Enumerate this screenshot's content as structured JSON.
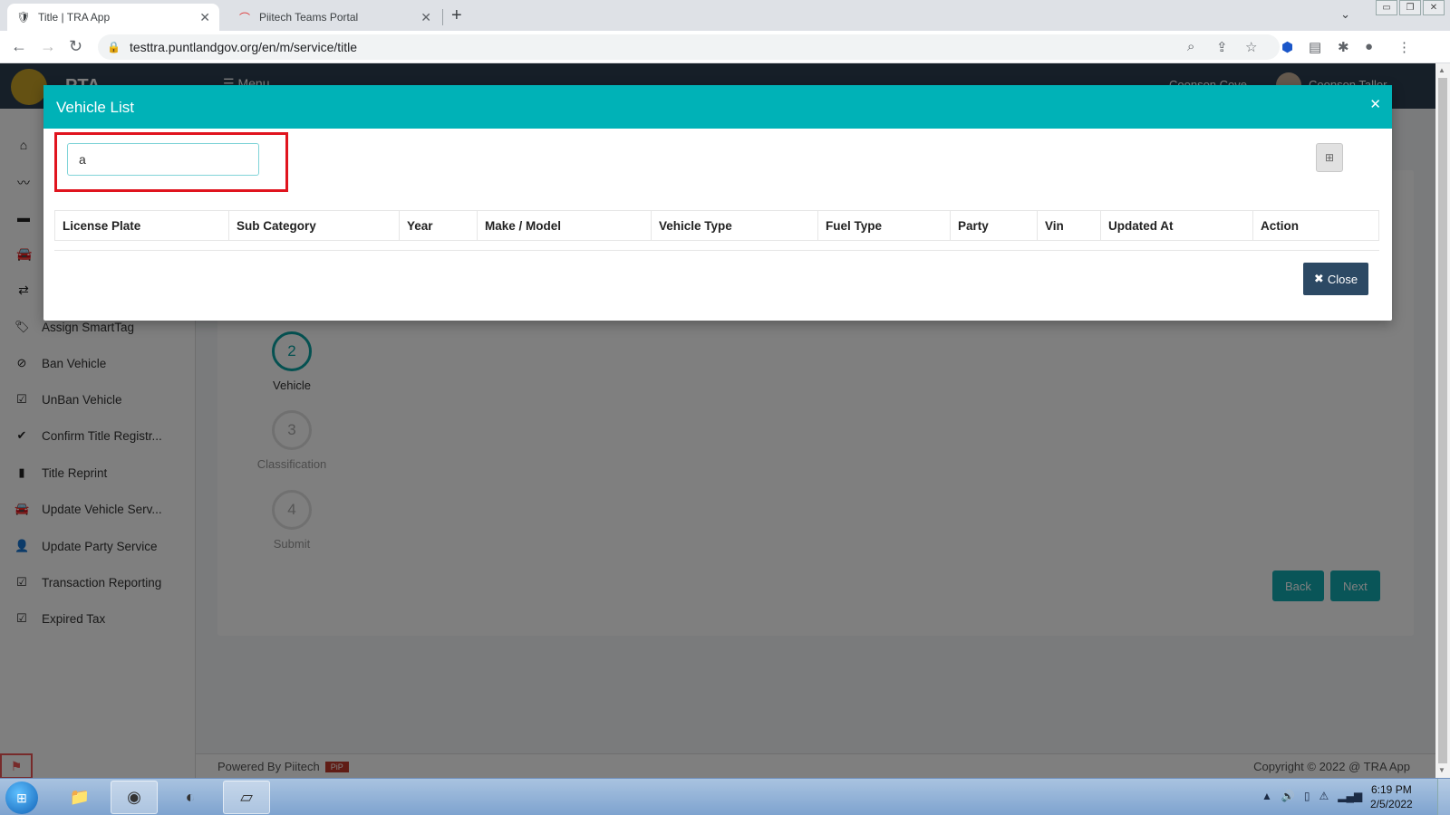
{
  "browser": {
    "tabs": [
      {
        "title": "Title | TRA App",
        "active": true
      },
      {
        "title": "Piitech Teams Portal",
        "active": false
      }
    ],
    "url": "testtra.puntlandgov.org/en/m/service/title"
  },
  "app": {
    "brand": "PTA",
    "menu_label": "Menu",
    "user_short": "Coonson Cove",
    "user_name": "Coonson Tallor"
  },
  "sidebar": {
    "items": [
      {
        "label": "Assign SmartTag",
        "icon": "tags-icon"
      },
      {
        "label": "Ban Vehicle",
        "icon": "ban-icon"
      },
      {
        "label": "UnBan Vehicle",
        "icon": "check-square-icon"
      },
      {
        "label": "Confirm Title Registr...",
        "icon": "check-icon"
      },
      {
        "label": "Title Reprint",
        "icon": "file-icon"
      },
      {
        "label": "Update Vehicle Serv...",
        "icon": "car-icon"
      },
      {
        "label": "Update Party Service",
        "icon": "user-icon"
      },
      {
        "label": "Transaction Reporting",
        "icon": "check-square-icon"
      },
      {
        "label": "Expired Tax",
        "icon": "check-square-icon"
      }
    ]
  },
  "wizard": {
    "steps": [
      {
        "number": "2",
        "label": "Vehicle"
      },
      {
        "number": "3",
        "label": "Classification"
      },
      {
        "number": "4",
        "label": "Submit"
      }
    ],
    "back_label": "Back",
    "next_label": "Next"
  },
  "modal": {
    "title": "Vehicle List",
    "search_value": "a",
    "columns": [
      "License Plate",
      "Sub Category",
      "Year",
      "Make / Model",
      "Vehicle Type",
      "Fuel Type",
      "Party",
      "Vin",
      "Updated At",
      "Action"
    ],
    "close_label": "Close"
  },
  "footer": {
    "powered": "Powered By Piitech",
    "copyright": "Copyright © 2022 @ TRA App"
  },
  "taskbar": {
    "time": "6:19 PM",
    "date": "2/5/2022"
  }
}
